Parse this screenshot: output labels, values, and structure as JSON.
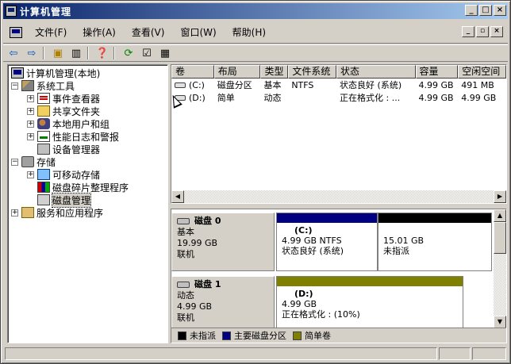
{
  "window": {
    "title": "计算机管理"
  },
  "menu": [
    {
      "label": "文件(F)"
    },
    {
      "label": "操作(A)"
    },
    {
      "label": "查看(V)"
    },
    {
      "label": "窗口(W)"
    },
    {
      "label": "帮助(H)"
    }
  ],
  "toolbar": [
    "back-icon",
    "forward-icon",
    "up-folder-icon",
    "show-hide-tree-icon",
    "help-icon",
    "refresh-icon",
    "properties-icon",
    "export-icon"
  ],
  "tree": {
    "root": "计算机管理(本地)",
    "system_tools": "系统工具",
    "event_viewer": "事件查看器",
    "shared_folders": "共享文件夹",
    "local_users": "本地用户和组",
    "perf_logs": "性能日志和警报",
    "device_manager": "设备管理器",
    "storage": "存储",
    "removable": "可移动存储",
    "defrag": "磁盘碎片整理程序",
    "disk_mgmt": "磁盘管理",
    "services": "服务和应用程序"
  },
  "volumes": {
    "columns": [
      "卷",
      "布局",
      "类型",
      "文件系统",
      "状态",
      "容量",
      "空闲空间"
    ],
    "rows": [
      [
        "(C:)",
        "磁盘分区",
        "基本",
        "NTFS",
        "状态良好 (系统)",
        "4.99 GB",
        "491 MB"
      ],
      [
        "(D:)",
        "简单",
        "动态",
        "",
        "正在格式化 : ...",
        "4.99 GB",
        "4.99 GB"
      ]
    ]
  },
  "disks": [
    {
      "name": "磁盘 0",
      "type": "基本",
      "size": "19.99 GB",
      "status": "联机",
      "partitions": [
        {
          "name": "(C:)",
          "detail": "4.99 GB NTFS",
          "status": "状态良好 (系统)",
          "color": "#000080"
        },
        {
          "name": "",
          "detail": "15.01 GB",
          "status": "未指派",
          "color": "#000000"
        }
      ]
    },
    {
      "name": "磁盘 1",
      "type": "动态",
      "size": "4.99 GB",
      "status": "联机",
      "partitions": [
        {
          "name": "(D:)",
          "detail": "4.99 GB",
          "status": "正在格式化 : (10%)",
          "color": "#808000"
        }
      ]
    }
  ],
  "legend": [
    {
      "label": "未指派",
      "color": "#000000"
    },
    {
      "label": "主要磁盘分区",
      "color": "#000080"
    },
    {
      "label": "简单卷",
      "color": "#808000"
    }
  ]
}
